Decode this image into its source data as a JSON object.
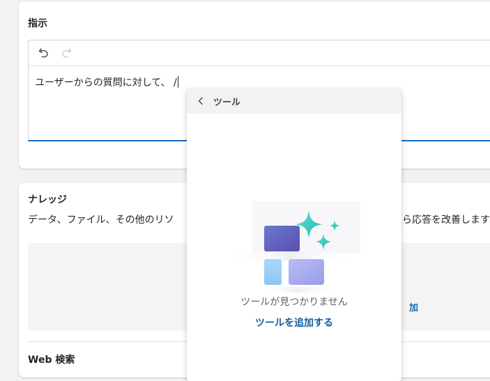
{
  "instructions": {
    "title": "指示",
    "toolbar": {
      "undo_icon": "undo-icon",
      "redo_icon": "redo-icon"
    },
    "editor_text": "ユーザーからの質問に対して、 /"
  },
  "knowledge": {
    "title": "ナレッジ",
    "description_left": "データ、ファイル、その他のリソ",
    "description_right": "ら応答を改善します",
    "add_link_partial": "加",
    "web_search_title": "Web 検索"
  },
  "tools_popup": {
    "back_icon": "chevron-left-icon",
    "title": "ツール",
    "empty_message": "ツールが見つかりません",
    "add_tool_label": "ツールを追加する"
  },
  "colors": {
    "accent": "#0f6cbd",
    "link": "#115ea3",
    "background": "#f3f2f1"
  }
}
